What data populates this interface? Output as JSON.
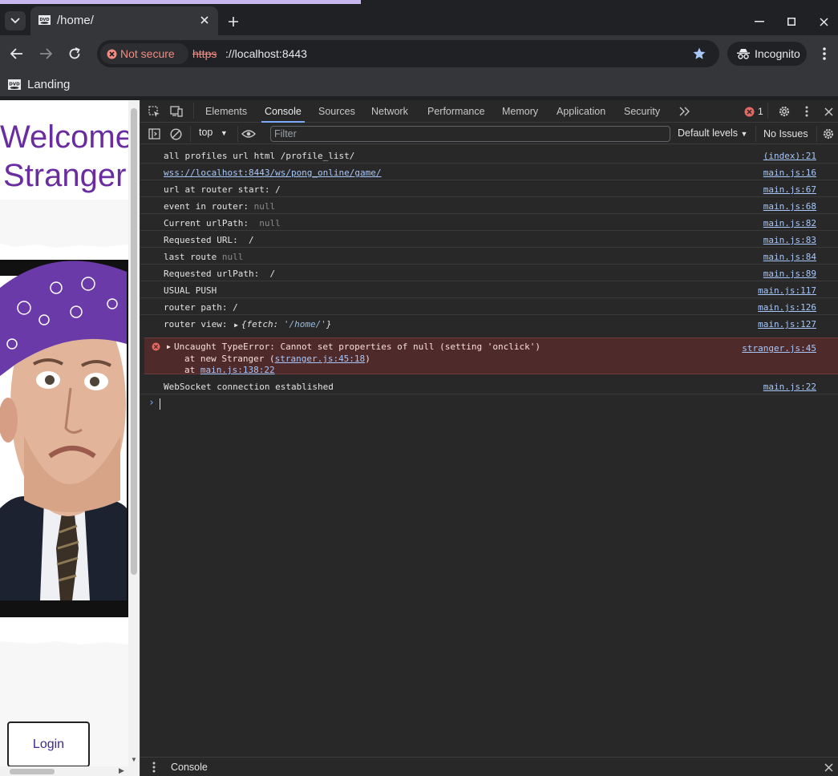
{
  "browser": {
    "tab_title": "/home/",
    "security_label": "Not secure",
    "url_scheme": "https",
    "url_rest": "://localhost:8443",
    "incognito_label": "Incognito",
    "bookmark_label": "Landing",
    "accent_color": "#a8c7fa",
    "warning_color": "#f28b82"
  },
  "page": {
    "heading_line1": "Welcome",
    "heading_line2": "Stranger",
    "login_label": "Login",
    "heading_color": "#6a2da0"
  },
  "devtools": {
    "tabs": [
      "Elements",
      "Console",
      "Sources",
      "Network",
      "Performance",
      "Memory",
      "Application",
      "Security"
    ],
    "active_tab": "Console",
    "error_count": "1",
    "context": "top",
    "filter_placeholder": "Filter",
    "levels_label": "Default levels",
    "issues_label": "No Issues",
    "drawer_tab": "Console",
    "messages": [
      {
        "text": "all profiles url html /profile_list/",
        "source": "(index):21"
      },
      {
        "text": "wss://localhost:8443/ws/pong_online/game/",
        "source": "main.js:16"
      },
      {
        "text": "url at router start: /",
        "source": "main.js:67"
      },
      {
        "text": "event in router:",
        "extra": "null",
        "source": "main.js:68"
      },
      {
        "text": "Current urlPath: ",
        "extra": "null",
        "source": "main.js:82"
      },
      {
        "text": "Requested URL:  /",
        "source": "main.js:83"
      },
      {
        "text": "last route",
        "extra": "null",
        "source": "main.js:84"
      },
      {
        "text": "Requested urlPath:  /",
        "source": "main.js:89"
      },
      {
        "text": "USUAL PUSH",
        "source": "main.js:117"
      },
      {
        "text": "router path: /",
        "source": "main.js:126"
      },
      {
        "text": "router view: ",
        "obj_key": "{fetch: ",
        "obj_val": "'/home/'",
        "obj_end": "}",
        "source": "main.js:127"
      }
    ],
    "error": {
      "line1": "Uncaught TypeError: Cannot set properties of null (setting 'onclick')",
      "line2_prefix": "at new Stranger (",
      "line2_link": "stranger.js:45:18",
      "line2_suffix": ")",
      "line3_prefix": "at ",
      "line3_link": "main.js:138:22",
      "source": "stranger.js:45"
    },
    "last_message": {
      "text": "WebSocket connection established",
      "source": "main.js:22"
    }
  }
}
